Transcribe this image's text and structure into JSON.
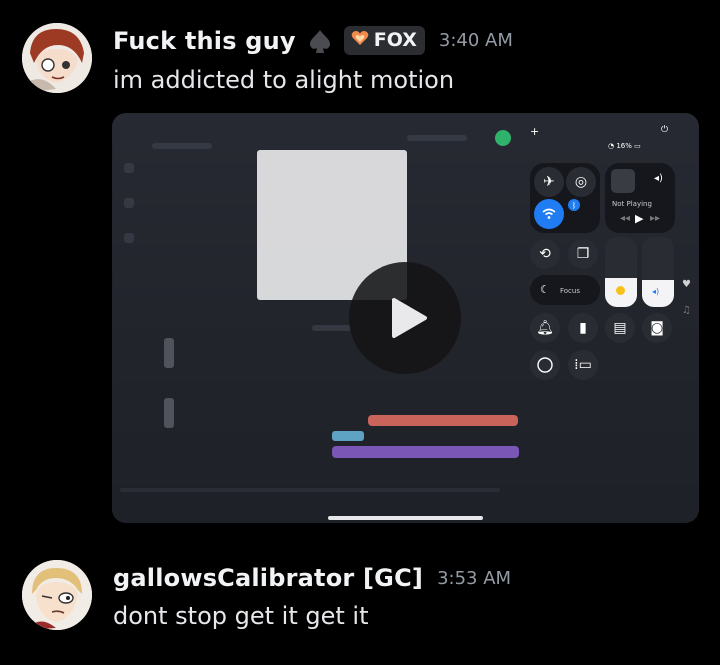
{
  "messages": [
    {
      "username": "Fuck this guy",
      "tag": "FOX",
      "timestamp": "3:40 AM",
      "content": "im addicted to alight motion"
    },
    {
      "username": "gallowsCalibrator [GC]",
      "timestamp": "3:53 AM",
      "content": "dont stop get it get it"
    }
  ],
  "video": {
    "status_battery": "16%",
    "cc_not_playing": "Not Playing",
    "cc_focus": "Focus"
  },
  "colors": {
    "background": "#000000",
    "username": "#f2f3f5",
    "timestamp": "#949ba4",
    "tag_bg": "#2b2d31",
    "track_red": "#c9645a",
    "track_purple": "#7a56b6",
    "cc_blue": "#1f7cf2"
  }
}
